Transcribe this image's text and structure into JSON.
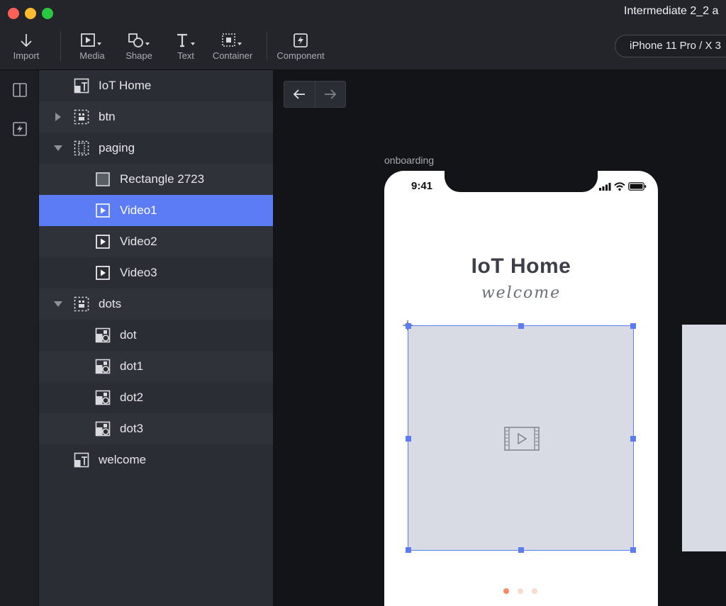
{
  "window": {
    "title": "Intermediate 2_2 a"
  },
  "toolbar": {
    "import": "Import",
    "media": "Media",
    "shape": "Shape",
    "text": "Text",
    "container": "Container",
    "component": "Component",
    "device": "iPhone 11 Pro / X  3"
  },
  "layers": [
    {
      "label": "IoT Home",
      "icon": "text-image-icon",
      "arrow": "none",
      "indent": 0
    },
    {
      "label": "btn",
      "icon": "container-icon",
      "arrow": "right",
      "indent": 0
    },
    {
      "label": "paging",
      "icon": "paging-container-icon",
      "arrow": "down",
      "indent": 0
    },
    {
      "label": "Rectangle 2723",
      "icon": "rectangle-icon",
      "arrow": "none",
      "indent": 1
    },
    {
      "label": "Video1",
      "icon": "video-icon",
      "arrow": "none",
      "indent": 1,
      "selected": true
    },
    {
      "label": "Video2",
      "icon": "video-icon",
      "arrow": "none",
      "indent": 1
    },
    {
      "label": "Video3",
      "icon": "video-icon",
      "arrow": "none",
      "indent": 1
    },
    {
      "label": "dots",
      "icon": "container-icon",
      "arrow": "down",
      "indent": 0
    },
    {
      "label": "dot",
      "icon": "shape-group-icon",
      "arrow": "none",
      "indent": 1
    },
    {
      "label": "dot1",
      "icon": "shape-group-icon",
      "arrow": "none",
      "indent": 1
    },
    {
      "label": "dot2",
      "icon": "shape-group-icon",
      "arrow": "none",
      "indent": 1
    },
    {
      "label": "dot3",
      "icon": "shape-group-icon",
      "arrow": "none",
      "indent": 1
    },
    {
      "label": "welcome",
      "icon": "text-image-icon",
      "arrow": "none",
      "indent": 0
    }
  ],
  "canvas": {
    "artboard_label": "onboarding",
    "status_time": "9:41",
    "app_title": "IoT Home",
    "app_subtitle": "welcome"
  },
  "colors": {
    "accent": "#5b7cf5",
    "dot_active": "#f58a6c",
    "dot_inactive": "#f7dccf"
  }
}
